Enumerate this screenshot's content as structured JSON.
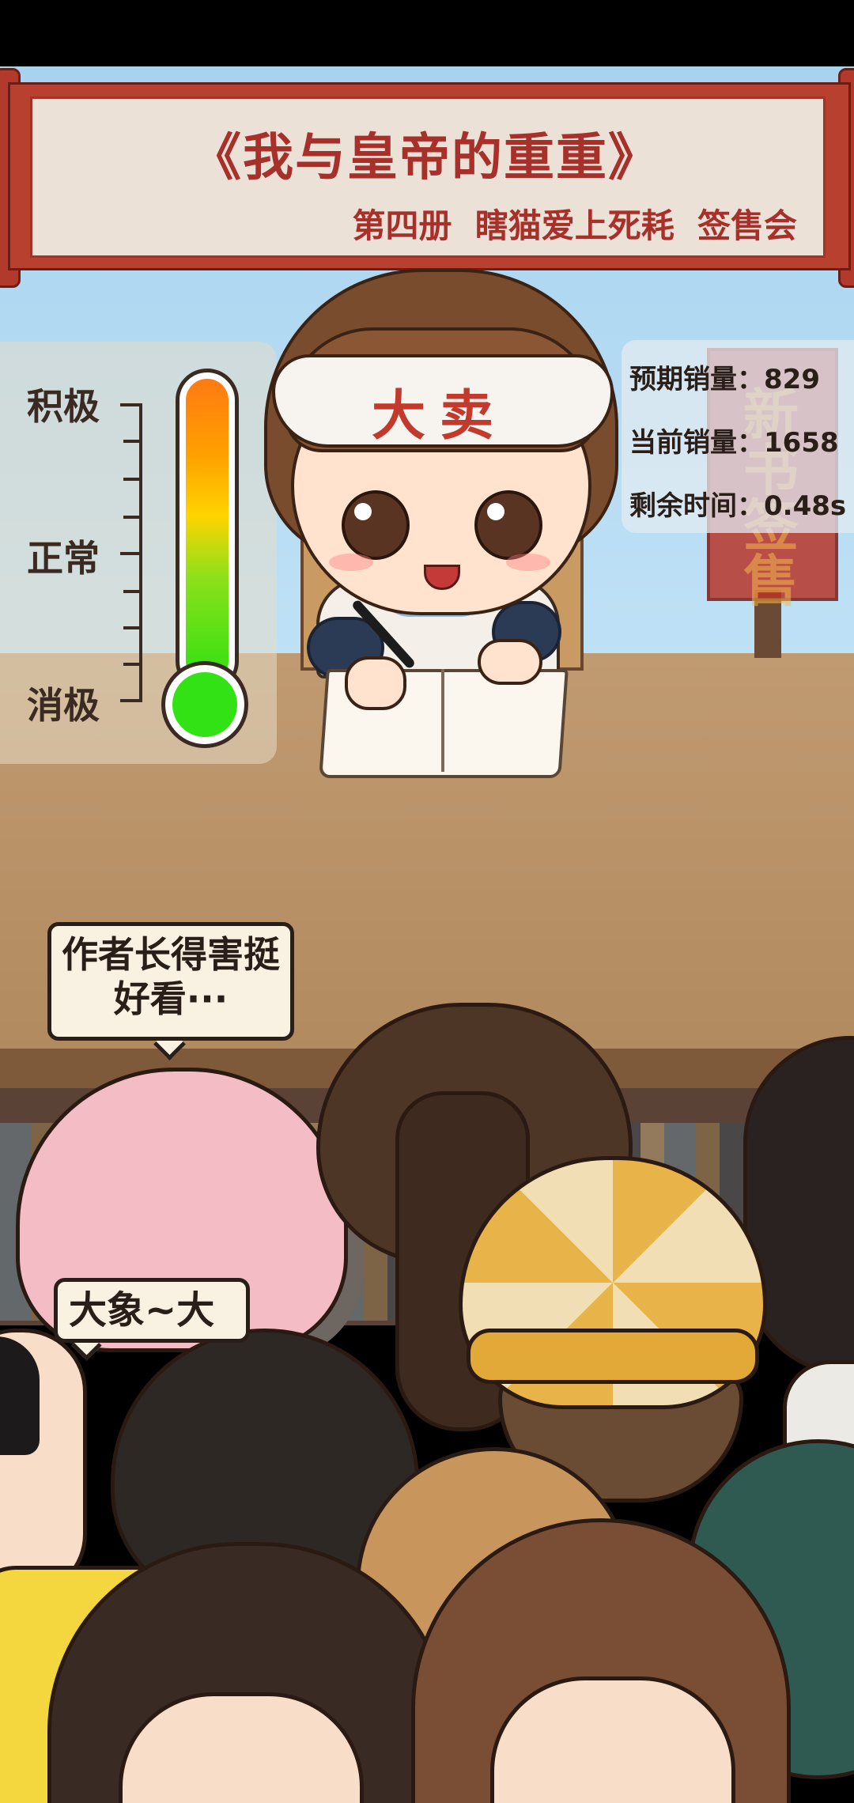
{
  "banner": {
    "title": "《我与皇帝的重重》",
    "subtitle": "第四册  瞎猫爱上死耗  签售会"
  },
  "author": {
    "headband_text": "大卖"
  },
  "sign": {
    "text": "新书签售"
  },
  "mood_meter": {
    "labels": [
      "积极",
      "正常",
      "消极"
    ],
    "level": 1.0
  },
  "stats": {
    "expected_sales": "预期销量：829",
    "current_sales": "当前销量：1658",
    "time_left": "剩余时间：0.48s"
  },
  "speech": {
    "bubble1": "作者长得害挺好看···",
    "bubble2": "大象~大"
  },
  "colors": {
    "banner_red": "#a8302a",
    "meter_top": "#ff7a12",
    "meter_bottom": "#33e214"
  }
}
